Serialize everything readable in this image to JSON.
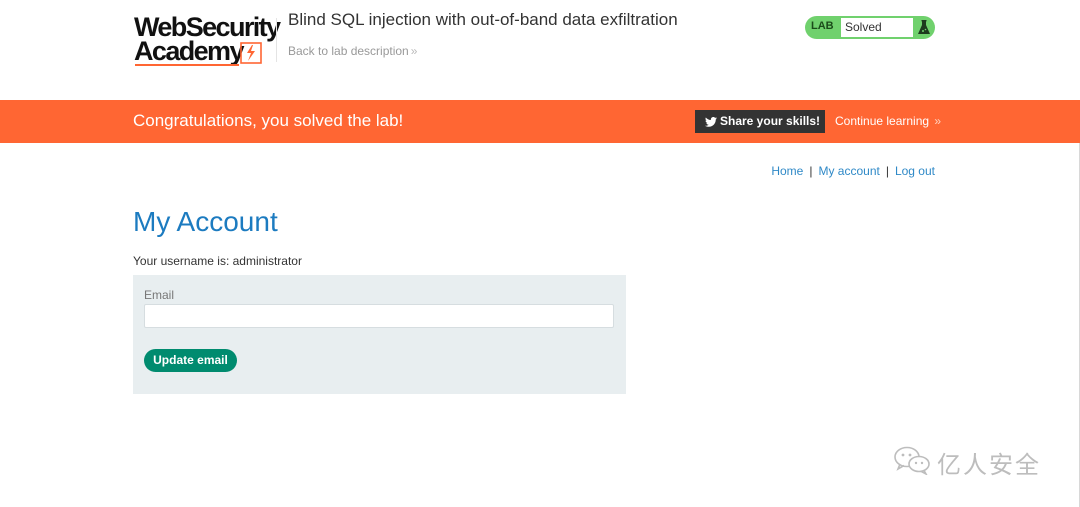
{
  "header": {
    "logo_line1": "WebSecurity",
    "logo_line2": "Academy",
    "lab_title": "Blind SQL injection with out-of-band data exfiltration",
    "back_link": "Back to lab description",
    "lab_status": {
      "tag": "LAB",
      "status": "Solved",
      "color": "#70d16d"
    }
  },
  "banner": {
    "message": "Congratulations, you solved the lab!",
    "share_label": "Share your skills!",
    "continue_label": "Continue learning",
    "color": "#ff6633"
  },
  "nav": {
    "items": [
      "Home",
      "My account",
      "Log out"
    ],
    "separator": "|"
  },
  "main": {
    "title": "My Account",
    "username_line": "Your username is: administrator",
    "email_form": {
      "label": "Email",
      "value": "",
      "button_label": "Update email"
    }
  },
  "watermark": {
    "text": "亿人安全"
  },
  "colors": {
    "accent_blue": "#1c7bc0",
    "link_blue": "#2f89c7",
    "button_green": "#008b6f",
    "panel_bg": "#e8eef0"
  }
}
